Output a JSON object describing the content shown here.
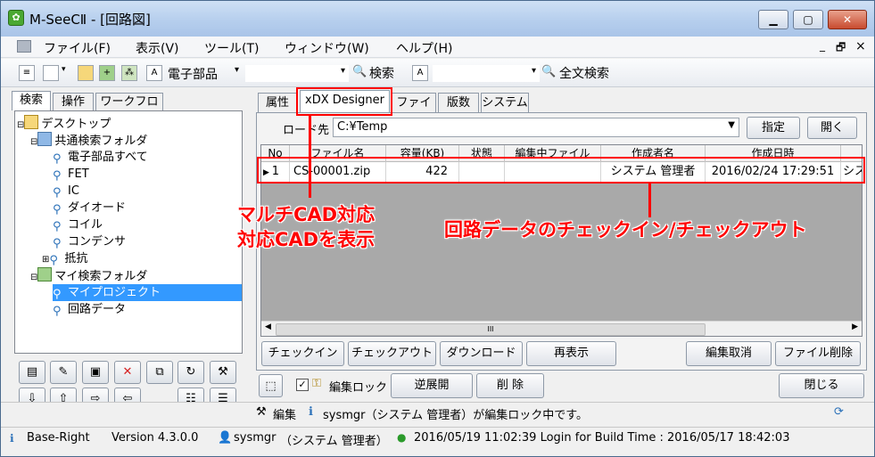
{
  "window": {
    "title": "M-SeeCⅡ - [回路図]",
    "min_label": "▁",
    "max_label": "▢",
    "close_label": "✕"
  },
  "menu": {
    "items": [
      "ファイル(F)",
      "表示(V)",
      "ツール(T)",
      "ウィンドウ(W)",
      "ヘルプ(H)"
    ],
    "mdi_min": "_",
    "mdi_restore": "🗗",
    "mdi_close": "×"
  },
  "toolbar": {
    "category_value": "電子部品",
    "search_label": "検索",
    "fulltext_label": "全文検索",
    "text_icon": "A"
  },
  "left_tabs": [
    "検索",
    "操作",
    "ワークフロー"
  ],
  "tree": {
    "desktop": "デスクトップ",
    "common_folder": "共通検索フォルダ",
    "common_items": [
      "電子部品すべて",
      "FET",
      "IC",
      "ダイオード",
      "コイル",
      "コンデンサ",
      "抵抗"
    ],
    "my_folder": "マイ検索フォルダ",
    "my_items": [
      "マイプロジェクト",
      "回路データ"
    ]
  },
  "right_tabs": [
    "属性",
    "xDX Designer",
    "ファイル",
    "版数",
    "システム"
  ],
  "load": {
    "label": "ロード先",
    "path": "C:¥Temp",
    "specify_button": "指定",
    "open_button": "開く"
  },
  "grid": {
    "headers": [
      "No",
      "ファイル名",
      "容量(KB)",
      "状態",
      "編集中ファイル",
      "作成者名",
      "作成日時"
    ],
    "rows": [
      {
        "no": "1",
        "file": "CS-00001.zip",
        "size": "422",
        "status": "",
        "editing": "",
        "author": "システム 管理者",
        "date": "2016/02/24 17:29:51",
        "extra": "シス"
      }
    ],
    "scroll_thumb": "III"
  },
  "action_buttons": {
    "checkin": "チェックイン",
    "checkout": "チェックアウト",
    "download": "ダウンロード",
    "redisplay": "再表示",
    "cancel_edit": "編集取消",
    "delete_file": "ファイル削除"
  },
  "lower": {
    "edit_lock": "編集ロック",
    "reverse": "逆展開",
    "delete": "削 除",
    "close": "閉じる"
  },
  "status": {
    "edit_label": "編集",
    "message": "sysmgr（システム 管理者）が編集ロック中です。"
  },
  "bottom": {
    "app": "Base-Right",
    "version": "Version 4.3.0.0",
    "user": "sysmgr",
    "user_name": "（システム 管理者）",
    "login": "2016/05/19 11:02:39 Login for Build Time : 2016/05/17 18:42:03"
  },
  "annotations": {
    "cad_line1": "マルチCAD対応",
    "cad_line2": "対応CADを表示",
    "checkin_note": "回路データのチェックイン/チェックアウト"
  },
  "colors": {
    "accent_red": "#ff0000",
    "selection": "#3399ff"
  }
}
